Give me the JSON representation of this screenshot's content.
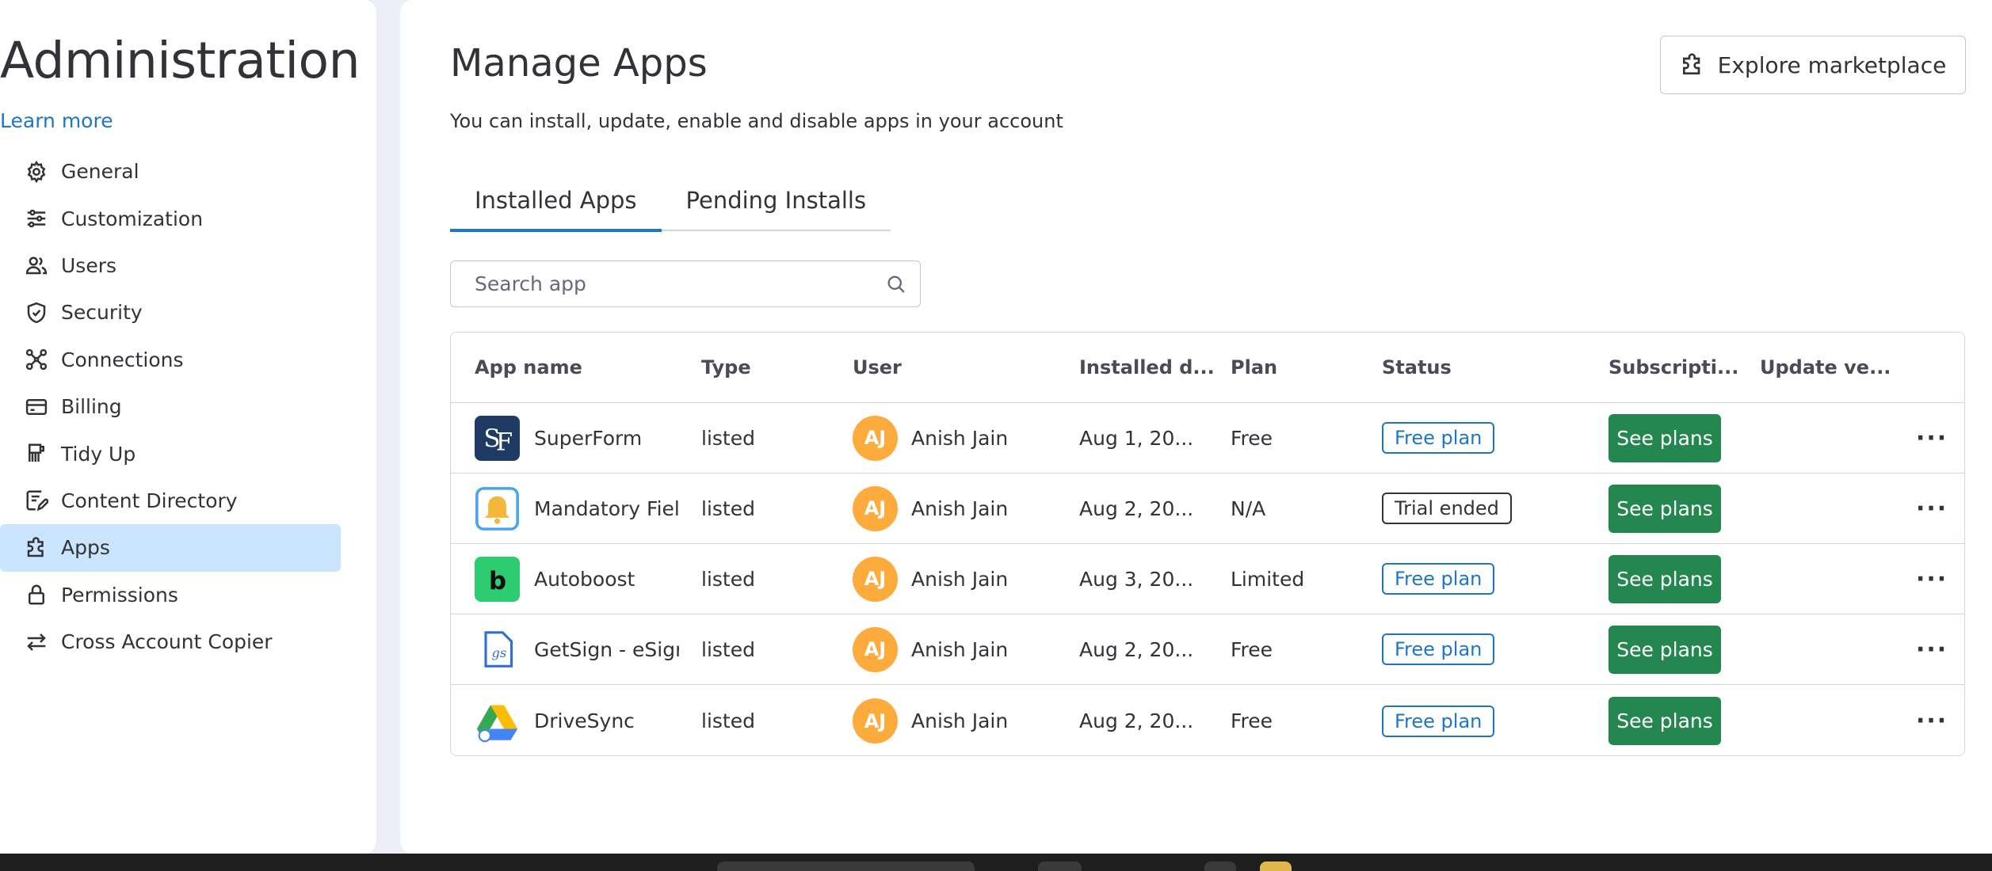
{
  "sidebar": {
    "title": "Administration",
    "learn_more": "Learn more",
    "items": [
      {
        "label": "General",
        "icon": "gear-icon"
      },
      {
        "label": "Customization",
        "icon": "sliders-icon"
      },
      {
        "label": "Users",
        "icon": "users-icon"
      },
      {
        "label": "Security",
        "icon": "shield-icon"
      },
      {
        "label": "Connections",
        "icon": "connections-icon"
      },
      {
        "label": "Billing",
        "icon": "credit-card-icon"
      },
      {
        "label": "Tidy Up",
        "icon": "broom-icon"
      },
      {
        "label": "Content Directory",
        "icon": "content-directory-icon"
      },
      {
        "label": "Apps",
        "icon": "puzzle-icon",
        "active": true
      },
      {
        "label": "Permissions",
        "icon": "lock-icon"
      },
      {
        "label": "Cross Account Copier",
        "icon": "arrows-swap-icon"
      }
    ]
  },
  "main": {
    "title": "Manage Apps",
    "subtitle": "You can install, update, enable and disable apps in your account",
    "explore_label": "Explore marketplace",
    "tabs": [
      {
        "label": "Installed Apps",
        "active": true
      },
      {
        "label": "Pending Installs",
        "active": false
      }
    ],
    "search": {
      "placeholder": "Search app"
    },
    "table": {
      "headers": [
        "App name",
        "Type",
        "User",
        "Installed d...",
        "Plan",
        "Status",
        "Subscripti...",
        "Update ve..."
      ],
      "rows": [
        {
          "app": "SuperForm",
          "logo": "superform-logo",
          "type": "listed",
          "user_initials": "AJ",
          "user": "Anish Jain",
          "installed": "Aug 1, 20...",
          "plan": "Free",
          "status": "Free plan",
          "action": "See plans"
        },
        {
          "app": "Mandatory Field",
          "logo": "mandatory-field-logo",
          "type": "listed",
          "user_initials": "AJ",
          "user": "Anish Jain",
          "installed": "Aug 2, 20...",
          "plan": "N/A",
          "status": "Trial ended",
          "action": "See plans"
        },
        {
          "app": "Autoboost",
          "logo": "autoboost-logo",
          "type": "listed",
          "user_initials": "AJ",
          "user": "Anish Jain",
          "installed": "Aug 3, 20...",
          "plan": "Limited",
          "status": "Free plan",
          "action": "See plans"
        },
        {
          "app": "GetSign - eSign",
          "logo": "getsign-logo",
          "type": "listed",
          "user_initials": "AJ",
          "user": "Anish Jain",
          "installed": "Aug 2, 20...",
          "plan": "Free",
          "status": "Free plan",
          "action": "See plans"
        },
        {
          "app": "DriveSync",
          "logo": "drivesync-logo",
          "type": "listed",
          "user_initials": "AJ",
          "user": "Anish Jain",
          "installed": "Aug 2, 20...",
          "plan": "Free",
          "status": "Free plan",
          "action": "See plans"
        }
      ]
    }
  },
  "colors": {
    "accent": "#1f76c2",
    "active_nav_bg": "#cce5ff",
    "see_plans_bg": "#258750",
    "avatar_bg": "#fdab3d",
    "page_bg": "#eceff8"
  }
}
